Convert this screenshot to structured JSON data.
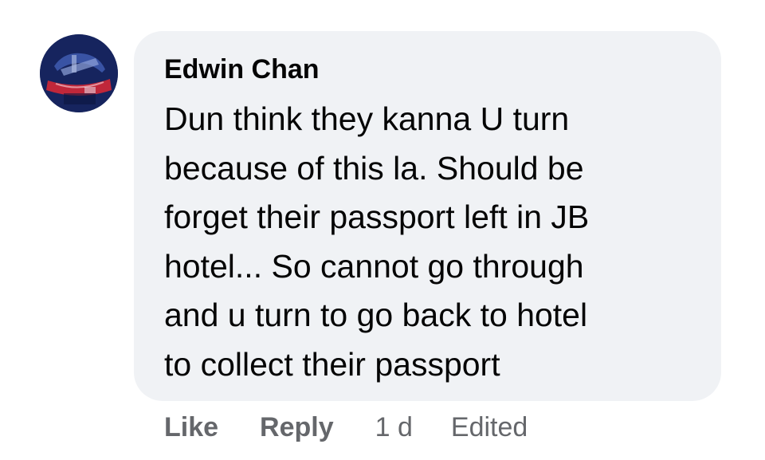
{
  "comment": {
    "author": "Edwin Chan",
    "lines": [
      "Dun think they kanna U turn",
      "because of this la. Should be",
      "forget their passport left in JB",
      "hotel... So cannot go through",
      "and u turn to go back to hotel",
      "to collect their passport"
    ]
  },
  "actions": {
    "like_label": "Like",
    "reply_label": "Reply",
    "timestamp": "1 d",
    "edited_label": "Edited"
  },
  "colors": {
    "bubble": "#f0f2f5",
    "text": "#050505",
    "meta": "#65676b"
  }
}
